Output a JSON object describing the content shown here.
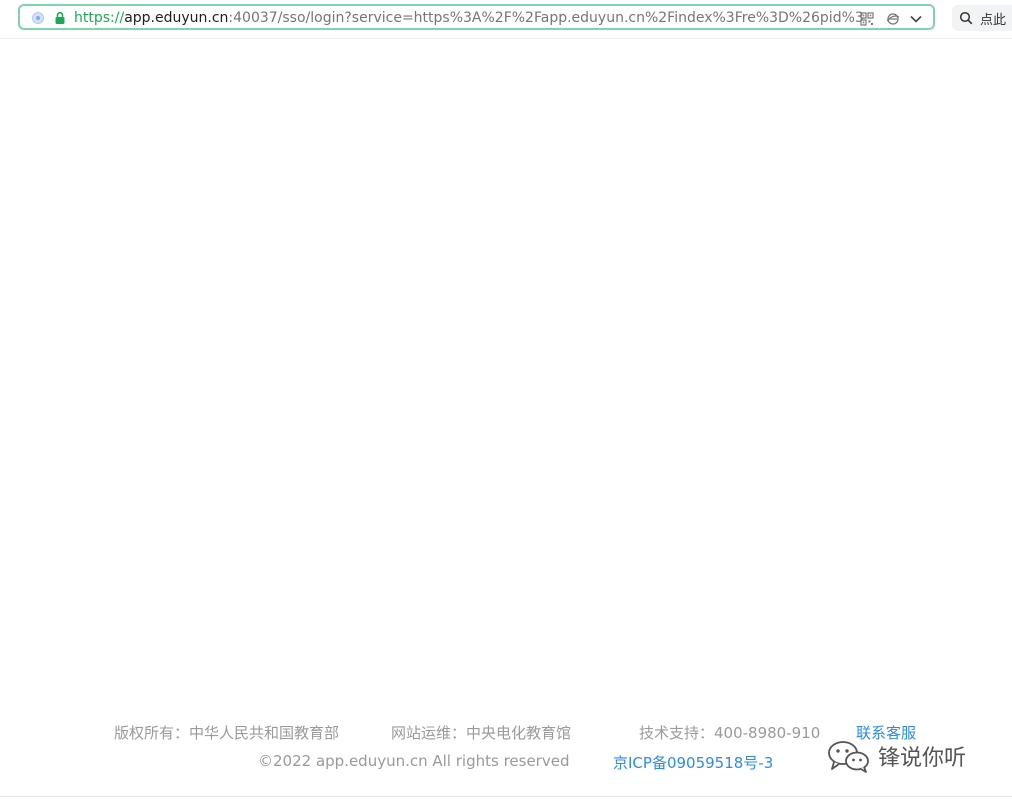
{
  "browser": {
    "url": {
      "scheme": "https://",
      "host": "app.eduyun.cn",
      "rest": ":40037/sso/login?service=https%3A%2F%2Fapp.eduyun.cn%2Findex%3Fre%3D%26pid%3D5%"
    },
    "search_placeholder": "点此",
    "colors": {
      "address_border": "#7fd3ad",
      "secure_green": "#1aaa55"
    }
  },
  "footer": {
    "copyright_owner": "版权所有：中华人民共和国教育部",
    "operator": "网站运维：中央电化教育馆",
    "support": "技术支持：400-8980-910",
    "contact_link": "联系客服",
    "rights": "©2022 app.eduyun.cn All rights reserved",
    "icp_link": "京ICP备09059518号-3",
    "link_color": "#2d8ce6"
  },
  "watermark": {
    "text": "锋说你听"
  }
}
